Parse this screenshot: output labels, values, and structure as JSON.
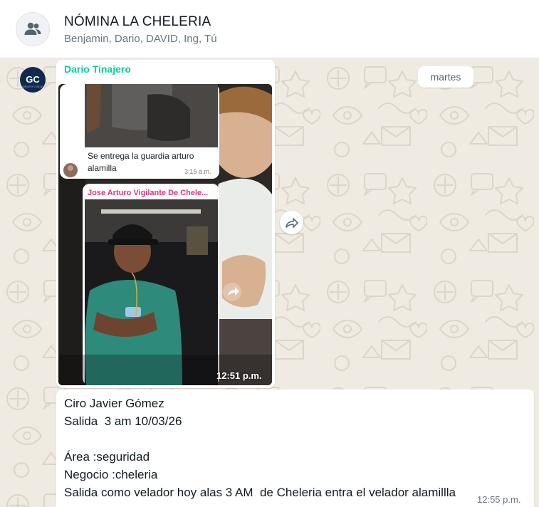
{
  "chat": {
    "title": "NÓMINA LA CHELERIA",
    "participants": "Benjamin, Dario, DAVID, Ing, Tú",
    "group_icon": "group-icon"
  },
  "date_chip": "martes",
  "message1": {
    "sender": "Dario Tinajero",
    "sender_color": "#06cf9c",
    "avatar_text": "GC",
    "time": "12:51 p.m.",
    "screenshot": {
      "quoted_text": "Se entrega la guardia arturo alamilla",
      "quoted_line1": "Se entrega la guardia arturo",
      "quoted_line2": "alamilla",
      "quoted_time": "3:15 a.m.",
      "forwarded_sender": "Jose Arturo Vigilante De Chele...",
      "forwarded_sender_color": "#e6317b"
    }
  },
  "message2": {
    "lines": [
      "Ciro Javier Gómez",
      "Salida  3 am 10/03/26",
      "",
      "Área :seguridad",
      "Negocio :cheleria",
      "Salida como velador hoy alas 3 AM  de Cheleria entra el velador alamillla"
    ],
    "time": "12:55 p.m."
  },
  "icons": {
    "forward": "forward-icon",
    "share": "share-icon"
  }
}
